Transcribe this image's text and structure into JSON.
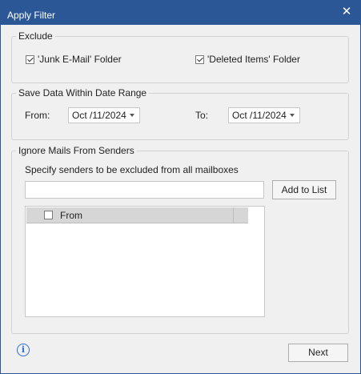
{
  "window": {
    "title": "Apply Filter",
    "close_icon": "close-icon"
  },
  "exclude": {
    "legend": "Exclude",
    "junk": {
      "label": "'Junk E-Mail' Folder",
      "checked": true
    },
    "deleted": {
      "label": "'Deleted Items' Folder",
      "checked": true
    }
  },
  "date_range": {
    "legend": "Save Data Within Date Range",
    "from_label": "From:",
    "from_value": "Oct /11/2024",
    "to_label": "To:",
    "to_value": "Oct /11/2024"
  },
  "ignore": {
    "legend": "Ignore Mails From Senders",
    "description": "Specify senders to be excluded from all mailboxes",
    "sender_input_value": "",
    "add_button": "Add to List",
    "list_header": "From",
    "header_checked": false
  },
  "footer": {
    "next_button": "Next",
    "info_icon": "info-icon"
  },
  "colors": {
    "titlebar": "#2b5797",
    "info": "#2a6fd6"
  }
}
